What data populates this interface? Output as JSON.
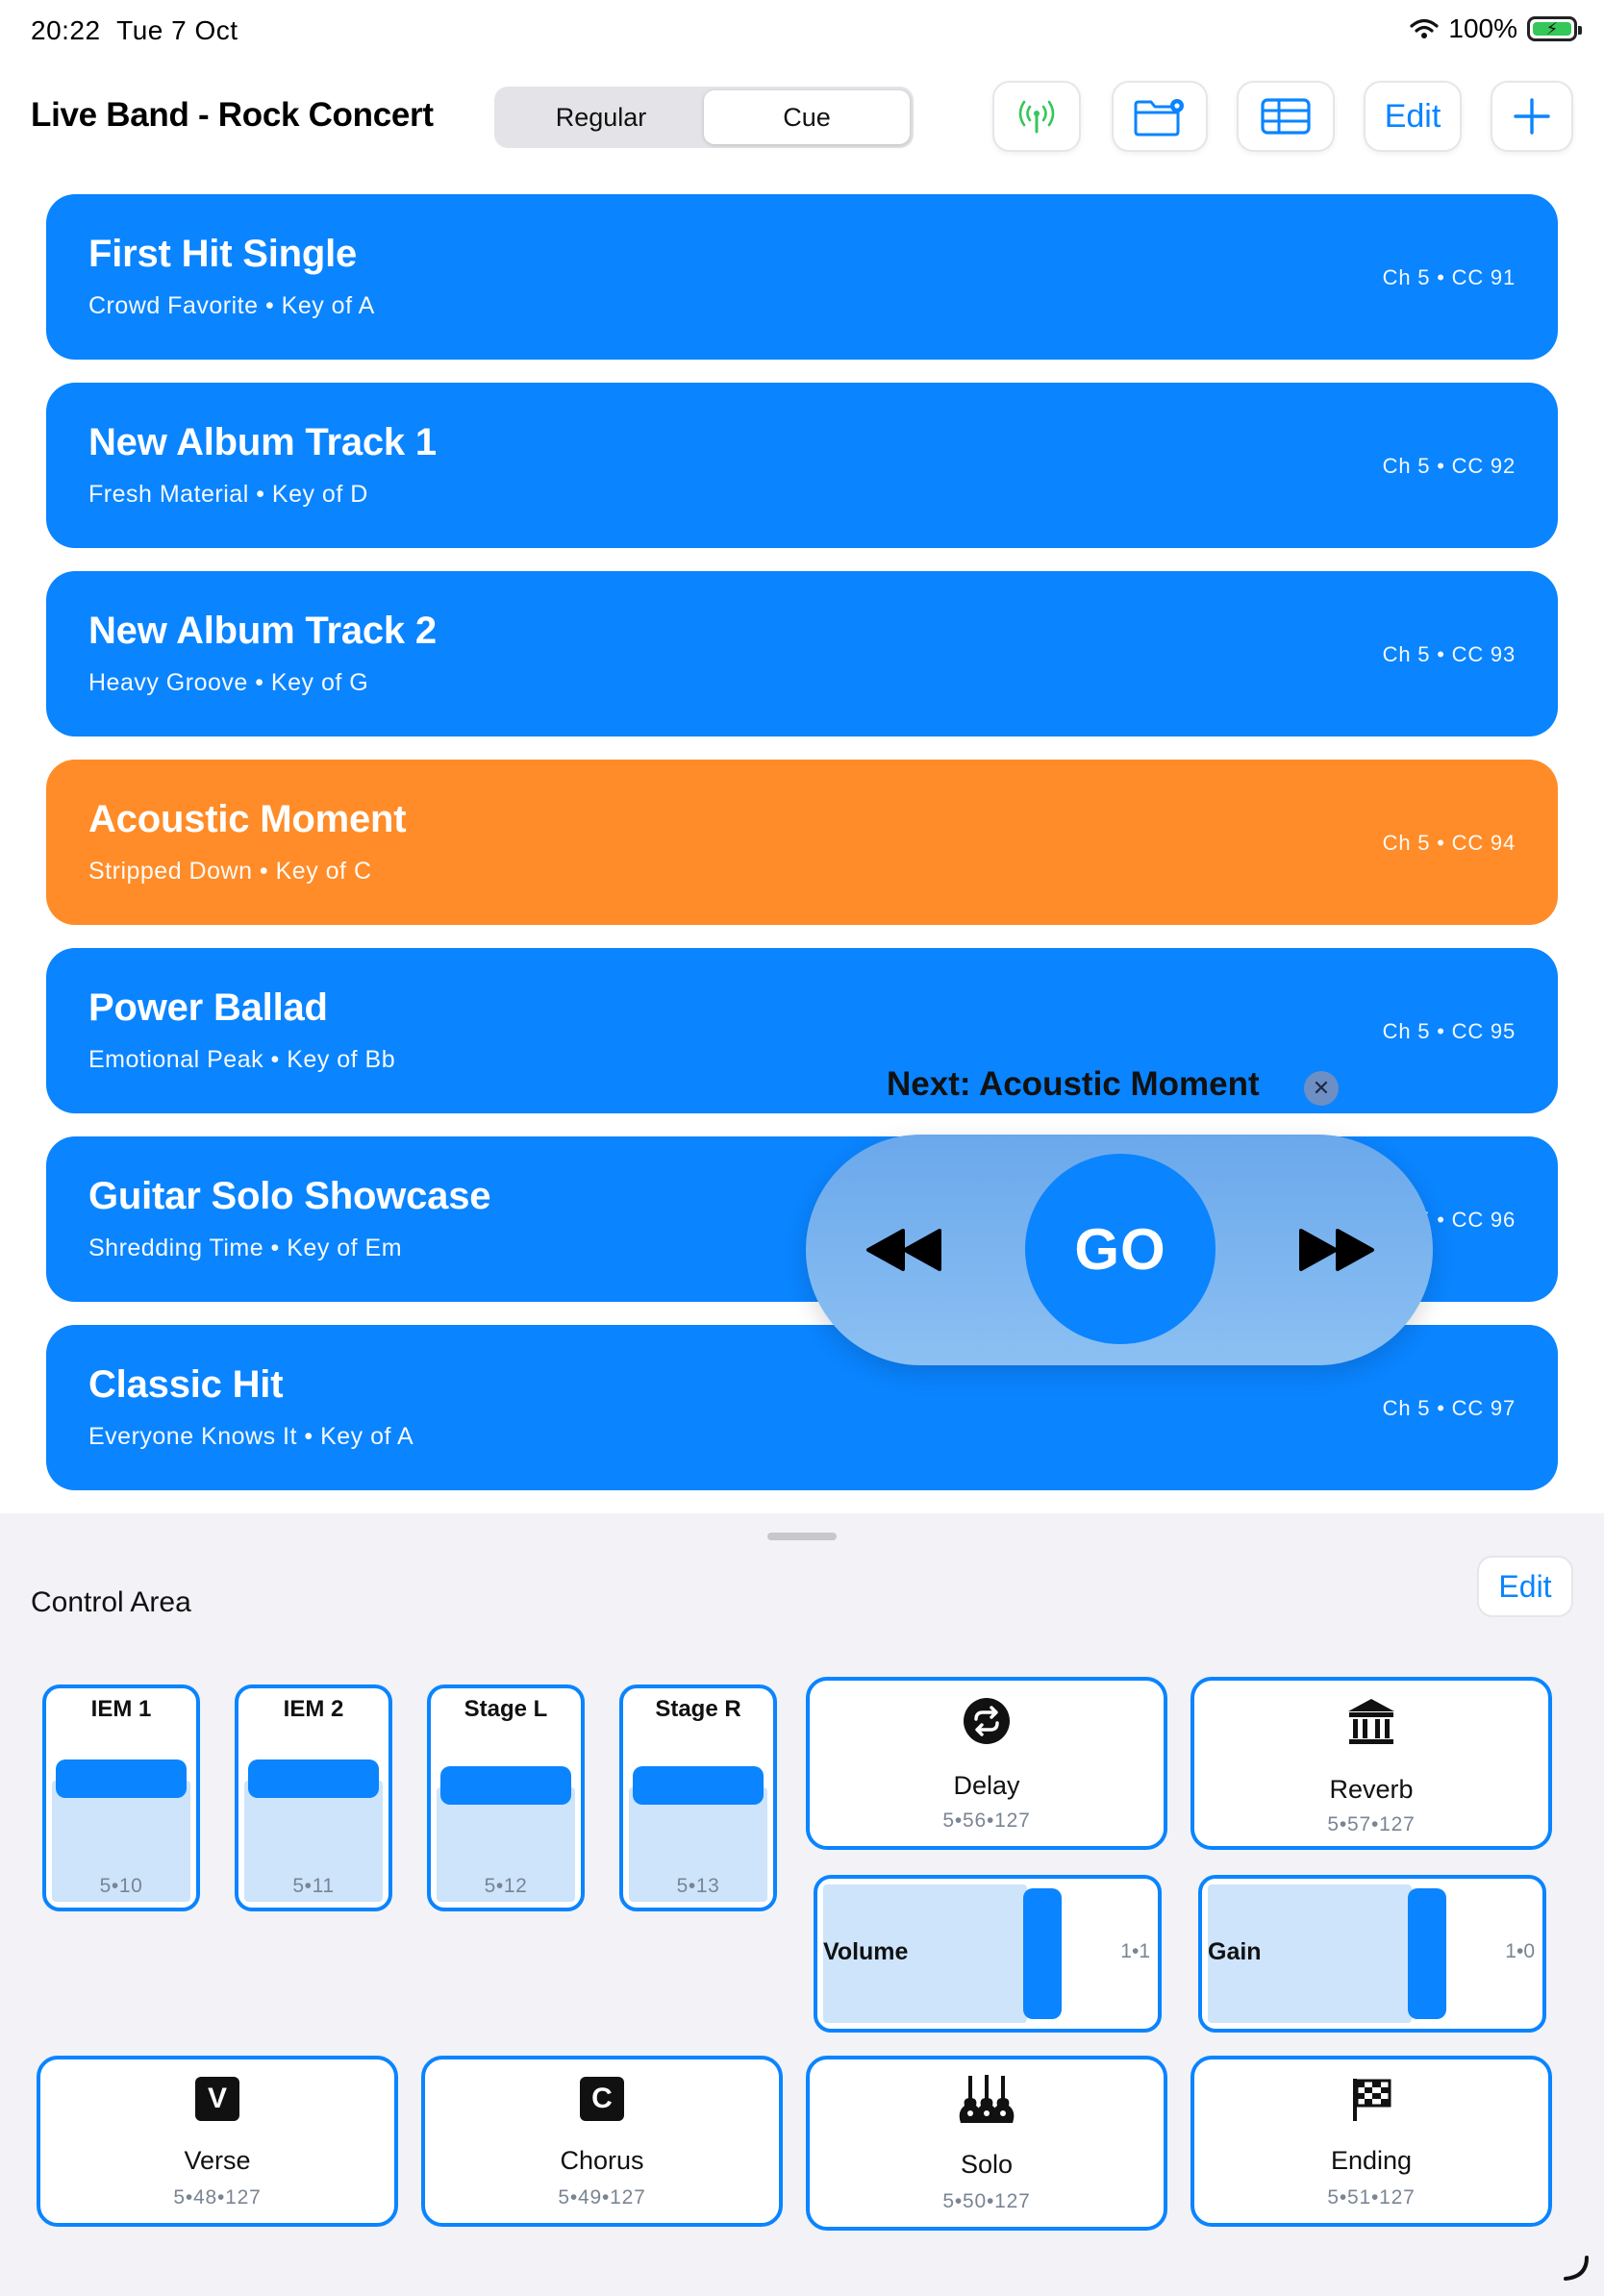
{
  "status": {
    "time": "20:22",
    "date": "Tue 7 Oct",
    "battery": "100%",
    "battery_level": 1.0
  },
  "toolbar": {
    "title": "Live Band - Rock Concert",
    "modes": [
      "Regular",
      "Cue"
    ],
    "active_mode": "Cue",
    "edit_label": "Edit",
    "icons": [
      "broadcast-icon",
      "folder-settings-icon",
      "table-icon",
      "plus-icon"
    ]
  },
  "songs": [
    {
      "title": "First Hit Single",
      "subtitle": "Crowd Favorite • Key of A",
      "cc": "Ch 5  •  CC 91",
      "active": false
    },
    {
      "title": "New Album Track 1",
      "subtitle": "Fresh Material • Key of D",
      "cc": "Ch 5  •  CC 92",
      "active": false
    },
    {
      "title": "New Album Track 2",
      "subtitle": "Heavy Groove • Key of G",
      "cc": "Ch 5  •  CC 93",
      "active": false
    },
    {
      "title": "Acoustic Moment",
      "subtitle": "Stripped Down • Key of C",
      "cc": "Ch 5  •  CC 94",
      "active": true
    },
    {
      "title": "Power Ballad",
      "subtitle": "Emotional Peak • Key of Bb",
      "cc": "Ch 5  •  CC 95",
      "active": false
    },
    {
      "title": "Guitar Solo Showcase",
      "subtitle": "Shredding Time • Key of Em",
      "cc": "Ch 5  •  CC 96",
      "active": false
    },
    {
      "title": "Classic Hit",
      "subtitle": "Everyone Knows It • Key of A",
      "cc": "Ch 5  •  CC 97",
      "active": false
    }
  ],
  "transport": {
    "next": "Next: Acoustic Moment",
    "go": "GO"
  },
  "control": {
    "title": "Control Area",
    "edit_label": "Edit",
    "faders": [
      {
        "label": "IEM 1",
        "value": "5•10",
        "level": 0.8
      },
      {
        "label": "IEM 2",
        "value": "5•11",
        "level": 0.8
      },
      {
        "label": "Stage L",
        "value": "5•12",
        "level": 0.75
      },
      {
        "label": "Stage R",
        "value": "5•13",
        "level": 0.75
      }
    ],
    "effects": [
      {
        "label": "Delay",
        "value": "5•56•127",
        "icon": "loop-icon"
      },
      {
        "label": "Reverb",
        "value": "5•57•127",
        "icon": "building-columns-icon"
      }
    ],
    "sliders": [
      {
        "label": "Volume",
        "value": "1•1",
        "level": 0.62
      },
      {
        "label": "Gain",
        "value": "1•0",
        "level": 0.62
      }
    ],
    "sections": [
      {
        "label": "Verse",
        "value": "5•48•127",
        "icon": "v-square-icon",
        "letter": "V"
      },
      {
        "label": "Chorus",
        "value": "5•49•127",
        "icon": "c-square-icon",
        "letter": "C"
      },
      {
        "label": "Solo",
        "value": "5•50•127",
        "icon": "guitars-icon"
      },
      {
        "label": "Ending",
        "value": "5•51•127",
        "icon": "checkered-flag-icon"
      }
    ]
  },
  "colors": {
    "accent": "#0a84ff",
    "active_song": "#ff8c28",
    "fader_fill": "#cde4fb",
    "broadcast": "#34c759"
  }
}
